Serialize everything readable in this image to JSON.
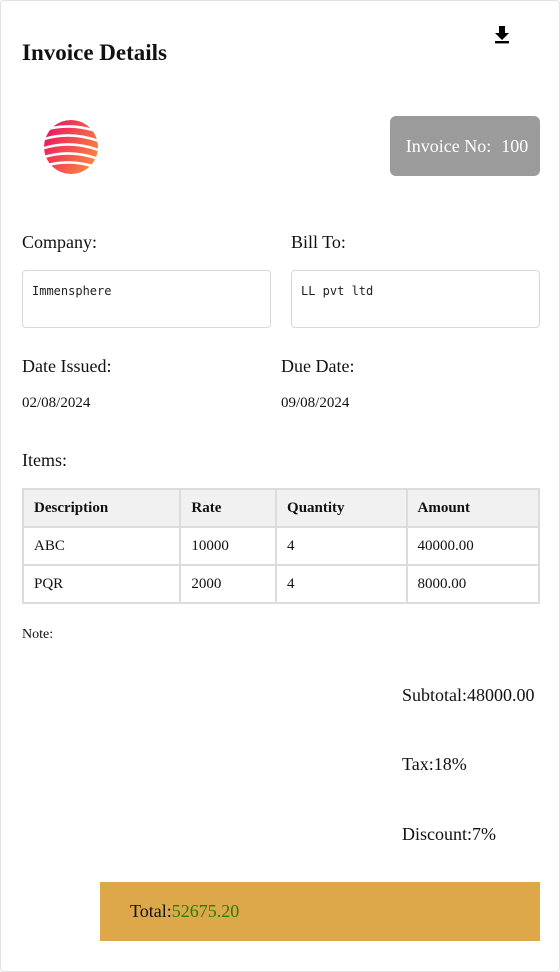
{
  "header": {
    "title": "Invoice Details",
    "download_icon": "download-icon"
  },
  "invoice": {
    "number_label": "Invoice No:",
    "number": "100"
  },
  "company": {
    "label": "Company:",
    "value": "Immensphere"
  },
  "bill_to": {
    "label": "Bill To:",
    "value": "LL pvt ltd"
  },
  "dates": {
    "issued_label": "Date Issued:",
    "issued_value": "02/08/2024",
    "due_label": "Due Date:",
    "due_value": "09/08/2024"
  },
  "items": {
    "label": "Items:",
    "columns": [
      "Description",
      "Rate",
      "Quantity",
      "Amount"
    ],
    "rows": [
      [
        "ABC",
        "10000",
        "4",
        "40000.00"
      ],
      [
        "PQR",
        "2000",
        "4",
        "8000.00"
      ]
    ]
  },
  "note": {
    "label": "Note:"
  },
  "summary": {
    "subtotal_label": "Subtotal:",
    "subtotal_value": "48000.00",
    "tax_label": "Tax:",
    "tax_value": "18%",
    "discount_label": "Discount:",
    "discount_value": "7%",
    "total_label": "Total:",
    "total_value": "52675.20"
  },
  "colors": {
    "invoice_badge": "#9b9b9b",
    "total_bar": "#dca84a",
    "total_value": "#2b7a0b",
    "logo_gradient_start": "#e8145f",
    "logo_gradient_end": "#ff8a3d"
  }
}
